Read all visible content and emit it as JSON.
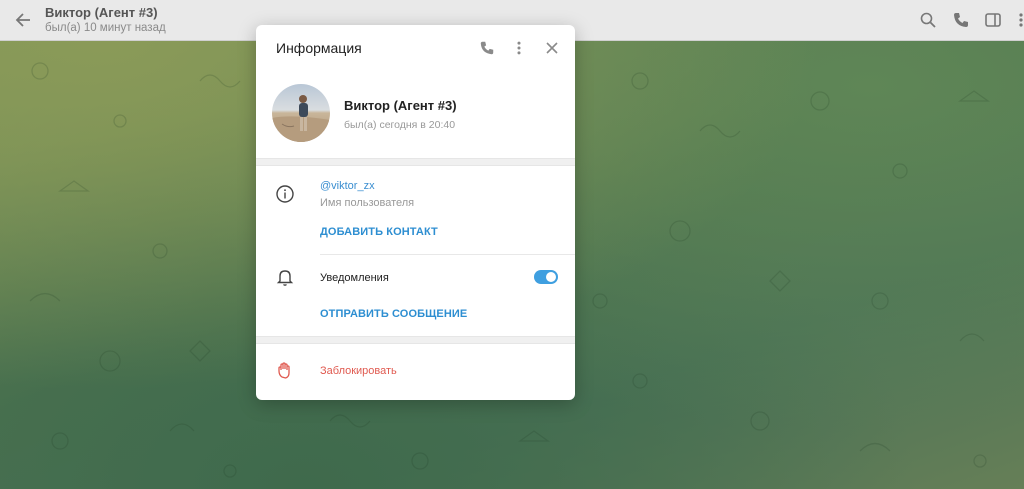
{
  "topbar": {
    "title": "Виктор (Агент #3)",
    "status": "был(а) 10 минут назад",
    "icons": [
      "back-arrow-icon",
      "search-icon",
      "phone-icon",
      "sidebar-toggle-icon",
      "more-icon"
    ]
  },
  "modal": {
    "title": "Информация",
    "header_icons": [
      "phone-icon",
      "more-vertical-icon",
      "close-icon"
    ],
    "profile": {
      "name": "Виктор (Агент #3)",
      "status": "был(а) сегодня в 20:40"
    },
    "info": {
      "username": "@viktor_zx",
      "username_label": "Имя пользователя",
      "add_contact": "ДОБАВИТЬ КОНТАКТ"
    },
    "notifications": {
      "label": "Уведомления",
      "enabled": true
    },
    "send_message": "ОТПРАВИТЬ СООБЩЕНИЕ",
    "block": "Заблокировать"
  },
  "colors": {
    "accent": "#2d8ed1",
    "toggle": "#3f9fe0",
    "danger": "#e05a50"
  }
}
